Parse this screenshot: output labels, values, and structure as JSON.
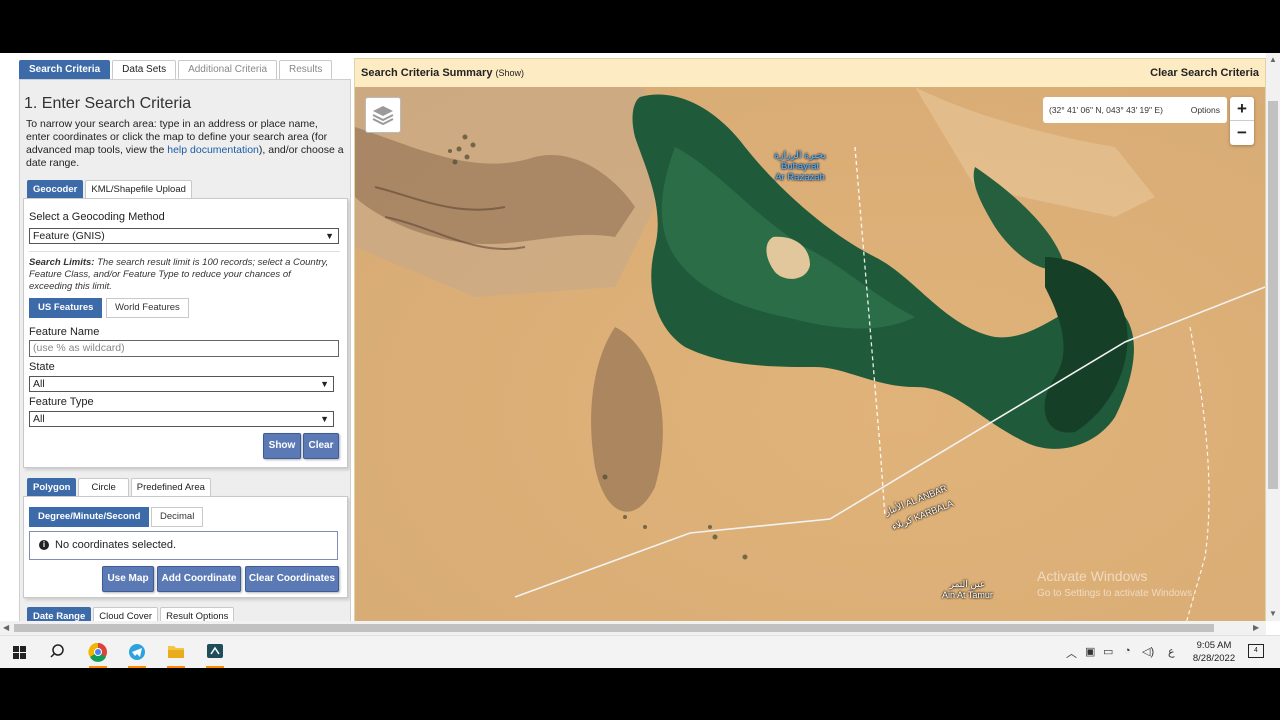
{
  "tabs": [
    "Search Criteria",
    "Data Sets",
    "Additional Criteria",
    "Results"
  ],
  "heading": "1. Enter Search Criteria",
  "intro": {
    "text_before": "To narrow your search area: type in an address or place name, enter coordinates or click the map to define your search area (for advanced map tools, view the ",
    "link": "help documentation",
    "text_after": "), and/or choose a date range."
  },
  "geocoder_tabs": [
    "Geocoder",
    "KML/Shapefile Upload"
  ],
  "geocoding": {
    "method_label": "Select a Geocoding Method",
    "method_value": "Feature (GNIS)",
    "limits_label": "Search Limits:",
    "limits_text": " The search result limit is 100 records; select a Country, Feature Class, and/or Feature Type to reduce your chances of exceeding this limit.",
    "feature_tabs": [
      "US Features",
      "World Features"
    ],
    "feature_name_label": "Feature Name",
    "feature_name_placeholder": "(use % as wildcard)",
    "state_label": "State",
    "state_value": "All",
    "feature_type_label": "Feature Type",
    "feature_type_value": "All",
    "show_btn": "Show",
    "clear_btn": "Clear"
  },
  "area_tabs": [
    "Polygon",
    "Circle",
    "Predefined Area"
  ],
  "coord_tabs": [
    "Degree/Minute/Second",
    "Decimal"
  ],
  "no_coords": "No coordinates selected.",
  "coord_buttons": [
    "Use Map",
    "Add Coordinate",
    "Clear Coordinates"
  ],
  "date_tabs": [
    "Date Range",
    "Cloud Cover",
    "Result Options"
  ],
  "map": {
    "summary_title": "Search Criteria Summary",
    "summary_show": "(Show)",
    "clear_search": "Clear Search Criteria",
    "coords": "(32° 41' 06\" N, 043° 43' 19\" E)",
    "options": "Options",
    "zoom_in": "+",
    "zoom_out": "−",
    "lake_ar": "بحيرة الرزازة",
    "lake_en1": "Buhayrat",
    "lake_en2": "Ar Razazah",
    "road_anbar": "AL ANBAR",
    "road_anbar_ar": "الأنبار",
    "road_karbala": "KARBALA",
    "road_karbala_ar": "كربلاء",
    "town_ar": "عين التمر",
    "town_en": "Ain At Tamur",
    "watermark1": "Activate Windows",
    "watermark2": "Go to Settings to activate Windows."
  },
  "taskbar": {
    "time": "9:05 AM",
    "date": "8/28/2022",
    "lang": "ع",
    "notif": "4"
  }
}
